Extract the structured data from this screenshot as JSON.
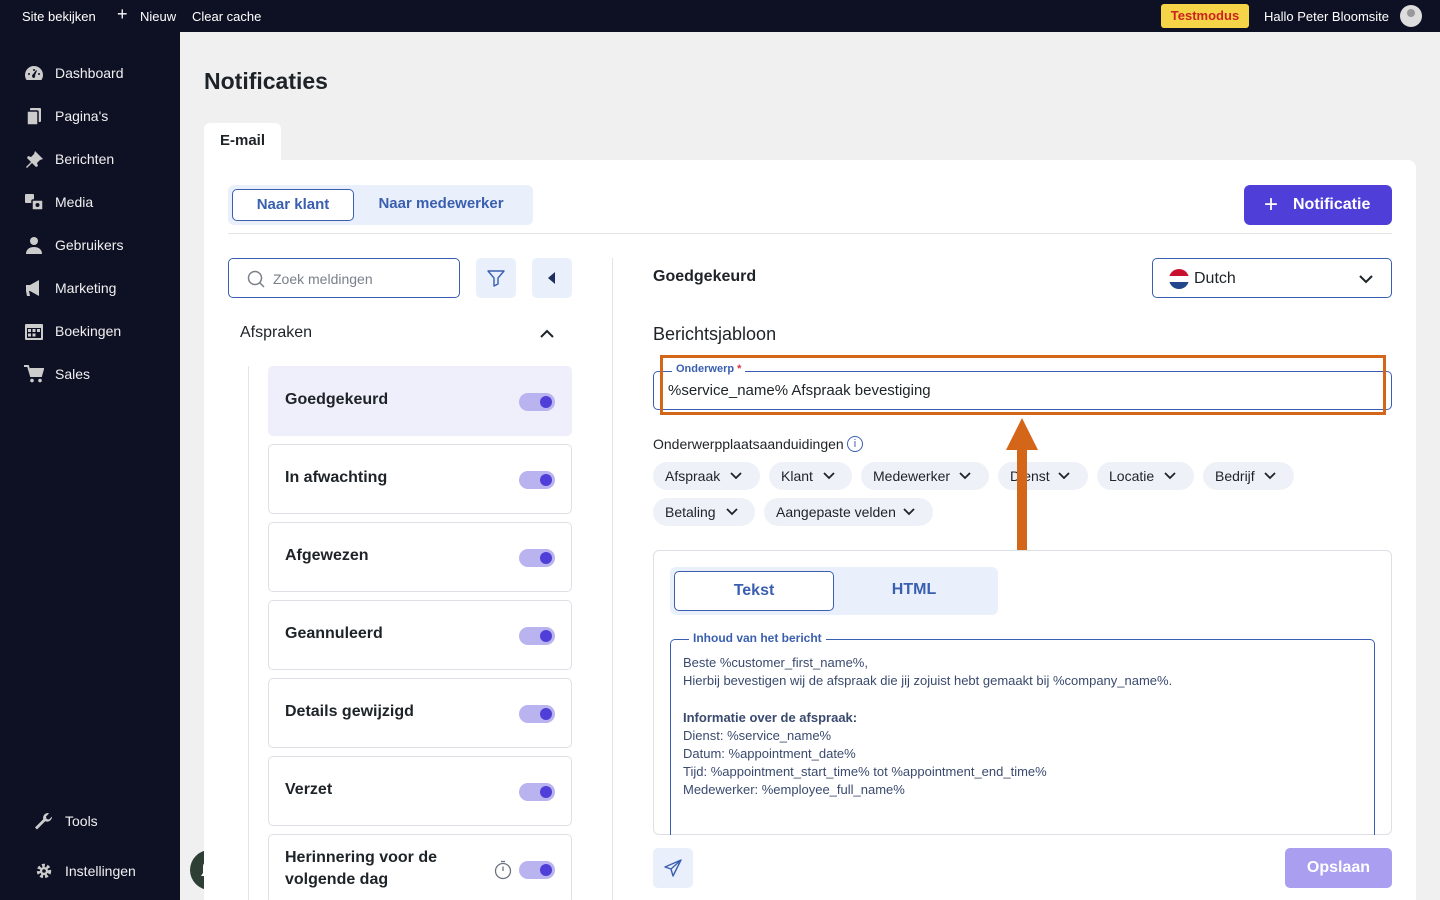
{
  "adminbar": {
    "view_site": "Site bekijken",
    "new": "Nieuw",
    "clear_cache": "Clear cache",
    "test_mode": "Testmodus",
    "greeting": "Hallo Peter Bloomsite"
  },
  "sidebar": {
    "items": [
      {
        "label": "Dashboard",
        "icon": "dashboard-icon"
      },
      {
        "label": "Pagina's",
        "icon": "pages-icon"
      },
      {
        "label": "Berichten",
        "icon": "pin-icon"
      },
      {
        "label": "Media",
        "icon": "media-icon"
      },
      {
        "label": "Gebruikers",
        "icon": "user-icon"
      },
      {
        "label": "Marketing",
        "icon": "megaphone-icon"
      },
      {
        "label": "Boekingen",
        "icon": "calendar-icon"
      },
      {
        "label": "Sales",
        "icon": "cart-icon"
      }
    ],
    "tools": "Tools",
    "settings": "Instellingen"
  },
  "page": {
    "title": "Notificaties",
    "tab_email": "E-mail"
  },
  "recipient_tabs": {
    "customer": "Naar klant",
    "employee": "Naar medewerker",
    "active": "customer"
  },
  "add_button": "Notificatie",
  "search": {
    "placeholder": "Zoek meldingen"
  },
  "group": {
    "label": "Afspraken",
    "expanded": true
  },
  "notifications": [
    {
      "name": "Goedgekeurd",
      "enabled": true,
      "active": true
    },
    {
      "name": "In afwachting",
      "enabled": true
    },
    {
      "name": "Afgewezen",
      "enabled": true
    },
    {
      "name": "Geannuleerd",
      "enabled": true
    },
    {
      "name": "Details gewijzigd",
      "enabled": true
    },
    {
      "name": "Verzet",
      "enabled": true
    },
    {
      "name": "Herinnering voor de volgende dag",
      "enabled": true,
      "has_timer": true
    }
  ],
  "detail": {
    "title": "Goedgekeurd",
    "language": "Dutch",
    "template_title": "Berichtsjabloon",
    "subject_label": "Onderwerp",
    "subject_required": "*",
    "subject_value": "%service_name% Afspraak bevestiging",
    "placeholders_label": "Onderwerpplaatsaanduidingen",
    "placeholder_chips": [
      "Afspraak",
      "Klant",
      "Medewerker",
      "Dienst",
      "Locatie",
      "Bedrijf",
      "Betaling",
      "Aangepaste velden"
    ],
    "editor_tabs": {
      "text": "Tekst",
      "html": "HTML",
      "active": "text"
    },
    "body_label": "Inhoud van het bericht",
    "body_lines": [
      "Beste %customer_first_name%,",
      "Hierbij bevestigen wij de afspraak die jij zojuist hebt gemaakt bij %company_name%.",
      "",
      "Informatie over de afspraak:",
      "Dienst: %service_name%",
      "Datum: %appointment_date%",
      "Tijd: %appointment_start_time% tot %appointment_end_time%",
      "Medewerker: %employee_full_name%"
    ],
    "save": "Opslaan"
  },
  "colors": {
    "accent": "#4f3fd8",
    "link": "#3a5fb0",
    "highlight": "#d4661a",
    "sidebar": "#0e1124"
  }
}
